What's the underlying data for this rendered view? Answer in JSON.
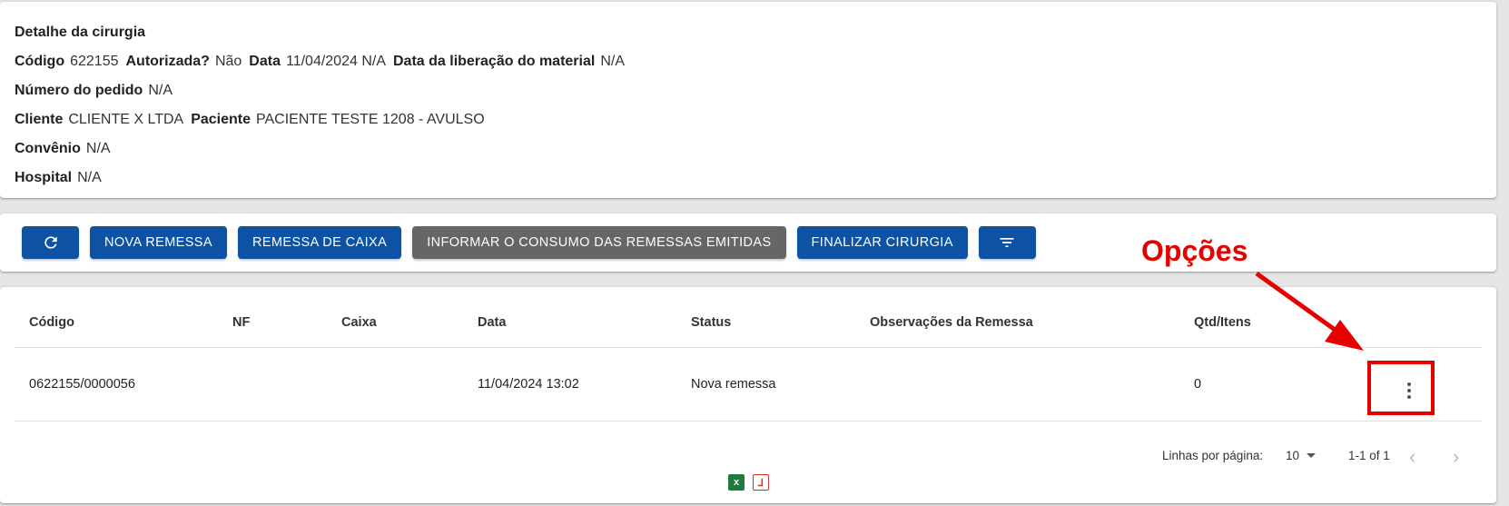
{
  "detail": {
    "title": "Detalhe da cirurgia",
    "codigo_label": "Código",
    "codigo": "622155",
    "autorizada_label": "Autorizada?",
    "autorizada": "Não",
    "data_label": "Data",
    "data": "11/04/2024 N/A",
    "liberacao_label": "Data da liberação do material",
    "liberacao": "N/A",
    "pedido_label": "Número do pedido",
    "pedido": "N/A",
    "cliente_label": "Cliente",
    "cliente": "CLIENTE X LTDA",
    "paciente_label": "Paciente",
    "paciente": "PACIENTE TESTE 1208 - AVULSO",
    "convenio_label": "Convênio",
    "convenio": "N/A",
    "hospital_label": "Hospital",
    "hospital": "N/A"
  },
  "toolbar": {
    "nova_remessa": "NOVA REMESSA",
    "remessa_caixa": "REMESSA DE CAIXA",
    "informar_consumo": "INFORMAR O CONSUMO DAS REMESSAS EMITIDAS",
    "finalizar": "FINALIZAR CIRURGIA",
    "refresh_icon": "refresh-icon",
    "filter_icon": "filter-icon"
  },
  "table": {
    "headers": [
      "Código",
      "NF",
      "Caixa",
      "Data",
      "Status",
      "Observações da Remessa",
      "Qtd/Itens"
    ],
    "rows": [
      [
        "0622155/0000056",
        "",
        "",
        "11/04/2024 13:02",
        "Nova remessa",
        "",
        "0"
      ]
    ]
  },
  "pagination": {
    "rows_per_page_label": "Linhas por página:",
    "rows_per_page": "10",
    "range": "1-1 of 1"
  },
  "annotation": {
    "label": "Opções"
  },
  "colors": {
    "primary": "#0d52a3",
    "disabled": "#666666",
    "annotation": "#e60000"
  }
}
